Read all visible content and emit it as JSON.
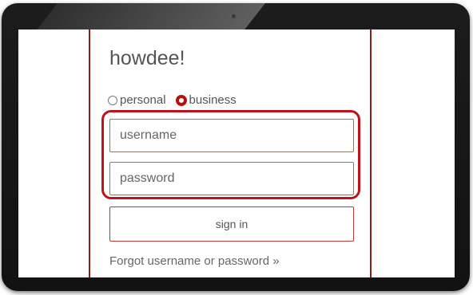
{
  "login": {
    "title": "howdee!",
    "account_types": [
      {
        "label": "personal",
        "selected": false
      },
      {
        "label": "business",
        "selected": true
      }
    ],
    "username": {
      "placeholder": "username",
      "value": ""
    },
    "password": {
      "placeholder": "password",
      "value": ""
    },
    "submit_label": "sign in",
    "forgot_link": "Forgot username or password »"
  },
  "theme": {
    "accent": "#b80f0f",
    "border": "#8b1c1c",
    "text": "#555555",
    "bezel": "#161616"
  }
}
